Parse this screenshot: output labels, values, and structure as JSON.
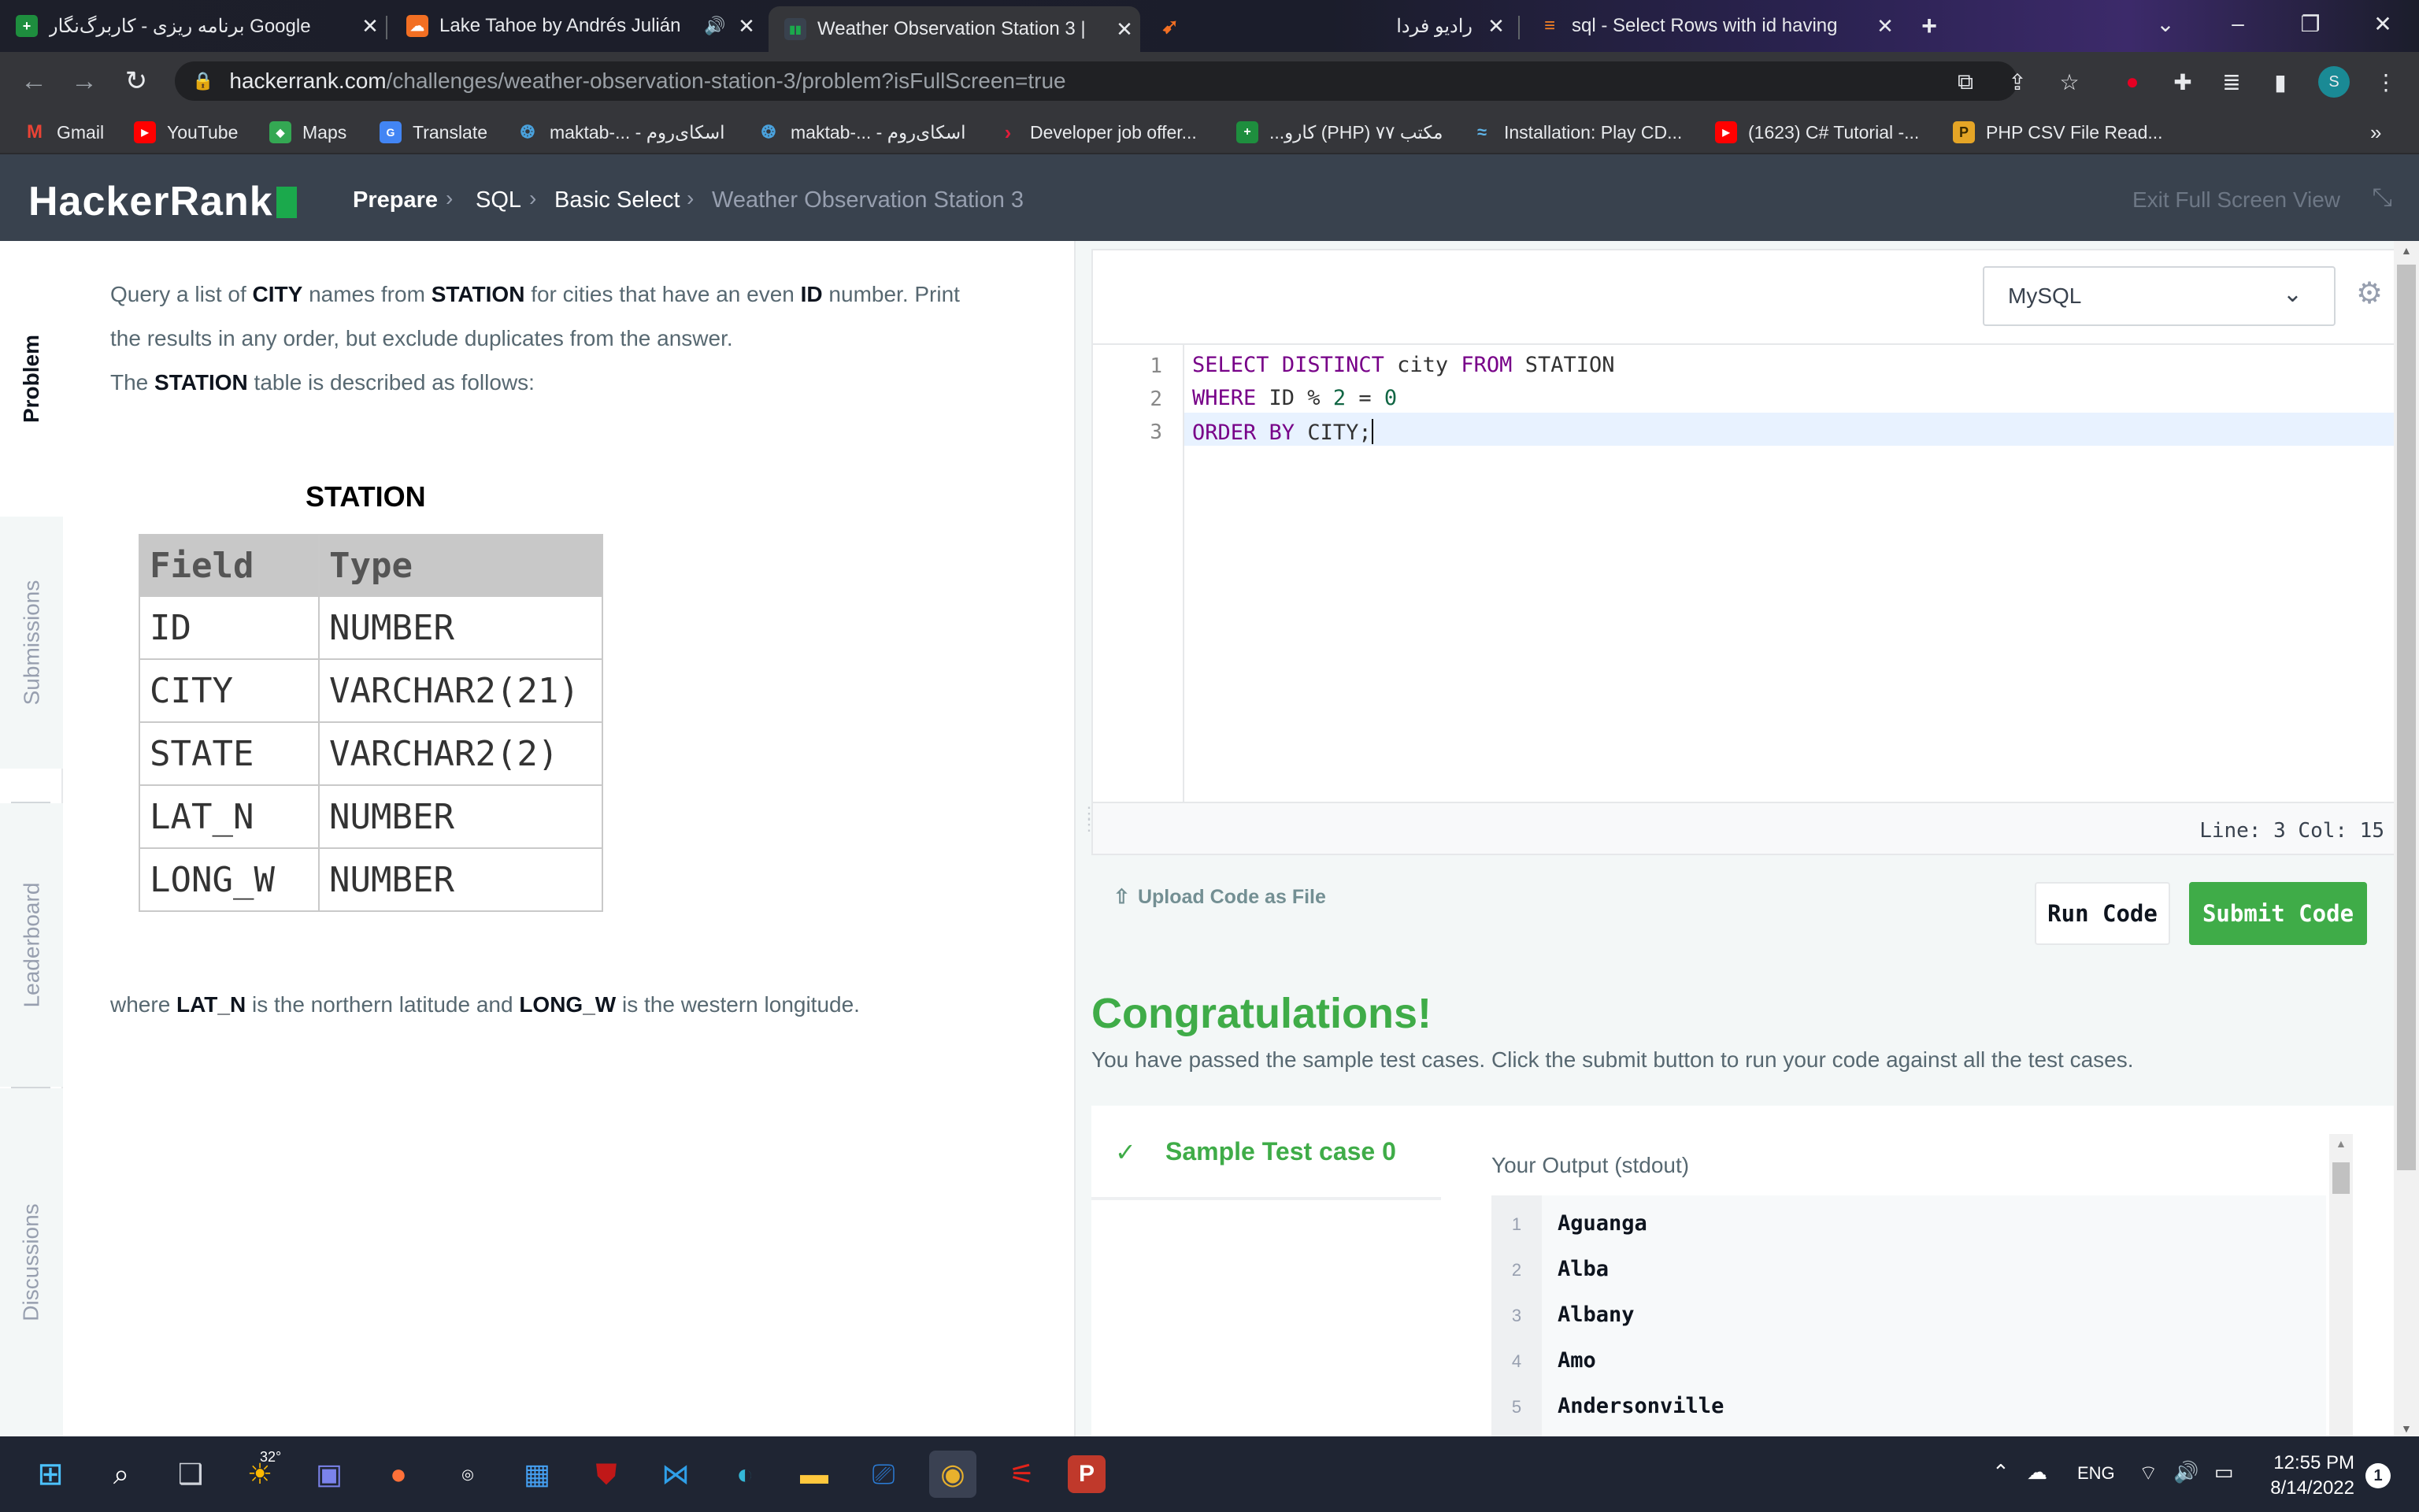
{
  "browser": {
    "tabs": [
      {
        "title": "برنامه ریزی - کاربرگ‌نگار Google",
        "icon": "sheets-icon"
      },
      {
        "title": "Lake Tahoe by Andrés Julián",
        "icon": "soundcloud-icon"
      },
      {
        "title": "Weather Observation Station 3 |",
        "icon": "hackerrank-icon"
      },
      {
        "title": "",
        "icon": "bird-icon"
      },
      {
        "title": "رادیو فردا",
        "icon": "radio-icon"
      },
      {
        "title": "sql - Select Rows with id having",
        "icon": "stackoverflow-icon"
      }
    ],
    "url_host": "hackerrank.com",
    "url_path": "/challenges/weather-observation-station-3/problem?isFullScreen=true",
    "profile_initial": "S",
    "bookmarks": [
      {
        "label": "Gmail"
      },
      {
        "label": "YouTube"
      },
      {
        "label": "Maps"
      },
      {
        "label": "Translate"
      },
      {
        "label": "maktab-... - اسکای‌روم"
      },
      {
        "label": "maktab-... - اسکای‌روم"
      },
      {
        "label": "Developer job offer..."
      },
      {
        "label": "...کارو (PHP) مکتب ۷۷"
      },
      {
        "label": "Installation: Play CD..."
      },
      {
        "label": "(1623) C# Tutorial -..."
      },
      {
        "label": "PHP CSV File Read..."
      }
    ],
    "more": "»"
  },
  "header": {
    "logo": "HackerRank",
    "crumbs": [
      "Prepare",
      "SQL",
      "Basic Select",
      "Weather Observation Station 3"
    ],
    "exit_label": "Exit Full Screen View"
  },
  "sidebar": {
    "tabs": [
      "Problem",
      "Submissions",
      "Leaderboard",
      "Discussions"
    ]
  },
  "problem": {
    "p1_a": "Query a list of ",
    "p1_b": "CITY",
    "p1_c": " names from ",
    "p1_d": "STATION",
    "p1_e": " for cities that have an even ",
    "p1_f": "ID",
    "p1_g": " number. Print",
    "p2": "the results in any order, but exclude duplicates from the answer.",
    "p3_a": "The ",
    "p3_b": "STATION",
    "p3_c": " table is described as follows:",
    "table_title": "STATION",
    "table_headers": [
      "Field",
      "Type"
    ],
    "table_rows": [
      [
        "ID",
        "NUMBER"
      ],
      [
        "CITY",
        "VARCHAR2(21)"
      ],
      [
        "STATE",
        "VARCHAR2(2)"
      ],
      [
        "LAT_N",
        "NUMBER"
      ],
      [
        "LONG_W",
        "NUMBER"
      ]
    ],
    "p4_a": "where ",
    "p4_b": "LAT_N",
    "p4_c": " is the northern latitude and ",
    "p4_d": "LONG_W",
    "p4_e": " is the western longitude."
  },
  "editor": {
    "language": "MySQL",
    "line_numbers": [
      "1",
      "2",
      "3"
    ],
    "line1": {
      "k1": "SELECT",
      "k2": "DISTINCT",
      "t1": " city ",
      "k3": "FROM",
      "t2": " STATION"
    },
    "line2": {
      "k1": "WHERE",
      "t1": " ID % ",
      "n1": "2",
      "t2": " = ",
      "n2": "0"
    },
    "line3": {
      "k1": "ORDER",
      "k2": "BY",
      "t1": " CITY;"
    },
    "status": "Line: 3 Col: 15",
    "upload_label": "Upload Code as File",
    "run_label": "Run Code",
    "submit_label": "Submit Code"
  },
  "result": {
    "title": "Congratulations!",
    "subtitle": "You have passed the sample test cases. Click the submit button to run your code against all the test cases.",
    "testcase": "Sample Test case 0",
    "output_label": "Your Output (stdout)",
    "output_lines": [
      {
        "n": "1",
        "v": "Aguanga"
      },
      {
        "n": "2",
        "v": "Alba"
      },
      {
        "n": "3",
        "v": "Albany"
      },
      {
        "n": "4",
        "v": "Amo"
      },
      {
        "n": "5",
        "v": "Andersonville"
      }
    ]
  },
  "taskbar": {
    "weather": "32°",
    "lang": "ENG",
    "time": "12:55 PM",
    "date": "8/14/2022",
    "notifications": "1"
  },
  "colors": {
    "header_bg": "#39424e",
    "green": "#3fac48",
    "keyword": "#770088",
    "number": "#116644"
  }
}
